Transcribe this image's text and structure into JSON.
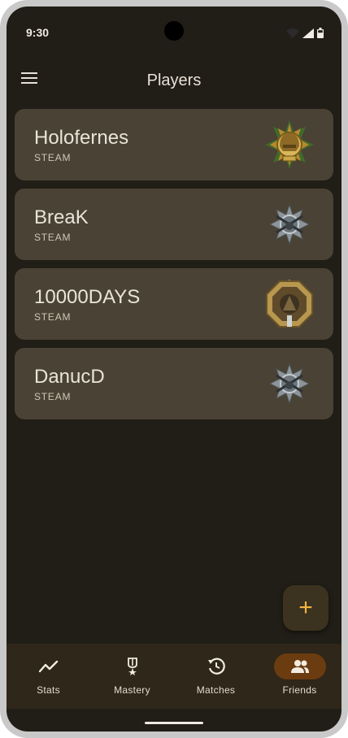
{
  "status": {
    "time": "9:30"
  },
  "appbar": {
    "title": "Players",
    "menu_icon": "menu-icon"
  },
  "players": [
    {
      "name": "Holofernes",
      "platform": "STEAM",
      "badge": "gold-helmet-rank-badge"
    },
    {
      "name": "BreaK",
      "platform": "STEAM",
      "badge": "silver-crossed-rifles-badge"
    },
    {
      "name": "10000DAYS",
      "platform": "STEAM",
      "badge": "bronze-octagon-badge"
    },
    {
      "name": "DanucD",
      "platform": "STEAM",
      "badge": "silver-crossed-rifles-badge"
    }
  ],
  "fab": {
    "label": "+",
    "icon": "plus-icon"
  },
  "nav": {
    "items": [
      {
        "label": "Stats",
        "icon": "stats-icon",
        "active": false
      },
      {
        "label": "Mastery",
        "icon": "mastery-icon",
        "active": false
      },
      {
        "label": "Matches",
        "icon": "history-icon",
        "active": false
      },
      {
        "label": "Friends",
        "icon": "friends-icon",
        "active": true
      }
    ]
  },
  "colors": {
    "background": "#211d17",
    "card": "#4a4234",
    "accent": "#f2b340",
    "nav_active": "#6a3c0f"
  }
}
